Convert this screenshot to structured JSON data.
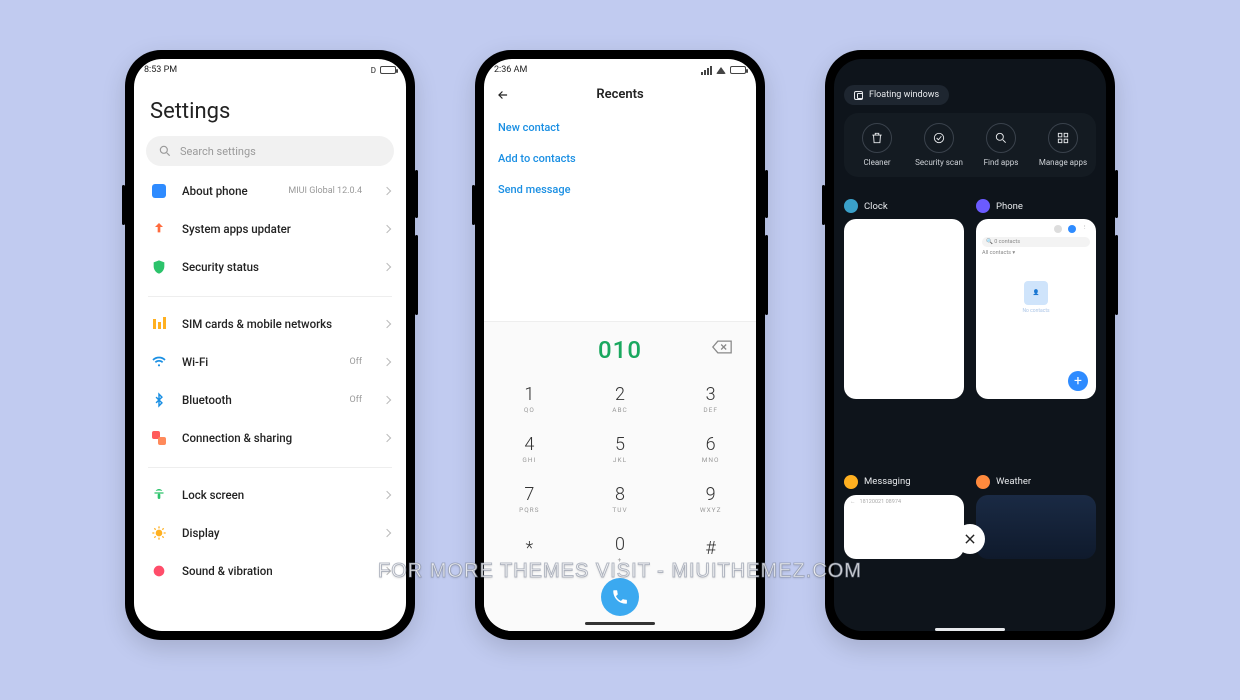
{
  "watermark": "FOR MORE THEMES VISIT - MIUITHEMEZ.COM",
  "settings": {
    "status_time": "8:53 PM",
    "title": "Settings",
    "search_placeholder": "Search settings",
    "groups": [
      {
        "items": [
          {
            "icon": "about",
            "color": "#2e8bff",
            "label": "About phone",
            "sub": "MIUI Global 12.0.4"
          },
          {
            "icon": "updater",
            "color": "#ff6b3d",
            "label": "System apps updater"
          },
          {
            "icon": "shield",
            "color": "#2cc36b",
            "label": "Security status"
          }
        ]
      },
      {
        "items": [
          {
            "icon": "sim",
            "color": "#ffb020",
            "label": "SIM cards & mobile networks"
          },
          {
            "icon": "wifi",
            "color": "#1a8fe3",
            "label": "Wi-Fi",
            "sub": "Off"
          },
          {
            "icon": "bt",
            "color": "#1a8fe3",
            "label": "Bluetooth",
            "sub": "Off"
          },
          {
            "icon": "share",
            "color": "#ff5b5b",
            "label": "Connection & sharing"
          }
        ]
      },
      {
        "items": [
          {
            "icon": "lock",
            "color": "#2cc36b",
            "label": "Lock screen"
          },
          {
            "icon": "display",
            "color": "#ffb020",
            "label": "Display"
          },
          {
            "icon": "sound",
            "color": "#ff4d6a",
            "label": "Sound & vibration"
          }
        ]
      }
    ]
  },
  "dialer": {
    "status_time": "2:36 AM",
    "title": "Recents",
    "actions": [
      "New contact",
      "Add to contacts",
      "Send message"
    ],
    "typed": "010",
    "keys": [
      {
        "n": "1",
        "l": "QO"
      },
      {
        "n": "2",
        "l": "ABC"
      },
      {
        "n": "3",
        "l": "DEF"
      },
      {
        "n": "4",
        "l": "GHI"
      },
      {
        "n": "5",
        "l": "JKL"
      },
      {
        "n": "6",
        "l": "MNO"
      },
      {
        "n": "7",
        "l": "PQRS"
      },
      {
        "n": "8",
        "l": "TUV"
      },
      {
        "n": "9",
        "l": "WXYZ"
      },
      {
        "n": "*",
        "l": ""
      },
      {
        "n": "0",
        "l": "+"
      },
      {
        "n": "#",
        "l": ""
      }
    ]
  },
  "recents": {
    "floating_label": "Floating windows",
    "tools": [
      {
        "icon": "trash",
        "label": "Cleaner"
      },
      {
        "icon": "scan",
        "label": "Security scan"
      },
      {
        "icon": "search",
        "label": "Find apps"
      },
      {
        "icon": "grid",
        "label": "Manage apps"
      }
    ],
    "cards": [
      {
        "name": "Clock",
        "icon_color": "#3aa0c9"
      },
      {
        "name": "Phone",
        "icon_color": "#6b5bff",
        "mini_search": "0 contacts",
        "mini_sub": "All contacts",
        "mini_empty": "No contacts"
      },
      {
        "name": "Messaging",
        "icon_color": "#ffb020"
      },
      {
        "name": "Weather",
        "icon_color": "#ff8a3d"
      }
    ]
  }
}
